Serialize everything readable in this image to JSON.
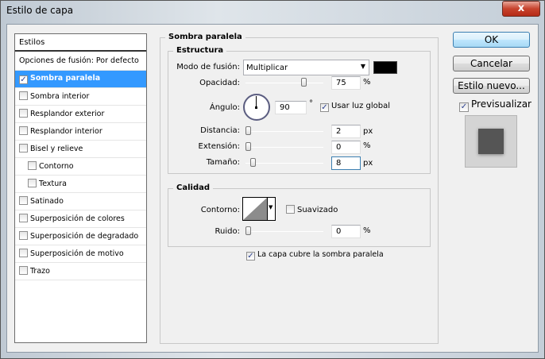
{
  "window": {
    "title": "Estilo de capa",
    "close": "x"
  },
  "sidebar": {
    "header": "Estilos",
    "items": [
      {
        "label": "Opciones de fusión: Por defecto",
        "checkbox": false
      },
      {
        "label": "Sombra paralela",
        "checked": true,
        "selected": true
      },
      {
        "label": "Sombra interior",
        "checked": false
      },
      {
        "label": "Resplandor exterior",
        "checked": false
      },
      {
        "label": "Resplandor interior",
        "checked": false
      },
      {
        "label": "Bisel y relieve",
        "checked": false
      },
      {
        "label": "Contorno",
        "checked": false,
        "indent": true
      },
      {
        "label": "Textura",
        "checked": false,
        "indent": true
      },
      {
        "label": "Satinado",
        "checked": false
      },
      {
        "label": "Superposición de colores",
        "checked": false
      },
      {
        "label": "Superposición de degradado",
        "checked": false
      },
      {
        "label": "Superposición de motivo",
        "checked": false
      },
      {
        "label": "Trazo",
        "checked": false
      }
    ]
  },
  "panel": {
    "title": "Sombra paralela",
    "structure": {
      "title": "Estructura",
      "blend_label": "Modo de fusión:",
      "blend_value": "Multiplicar",
      "color": "#000000",
      "opacity_label": "Opacidad:",
      "opacity": "75",
      "opacity_unit": "%",
      "angle_label": "Ángulo:",
      "angle": "90",
      "angle_unit": "°",
      "global_light": "Usar luz global",
      "global_light_checked": true,
      "distance_label": "Distancia:",
      "distance": "2",
      "distance_unit": "px",
      "spread_label": "Extensión:",
      "spread": "0",
      "spread_unit": "%",
      "size_label": "Tamaño:",
      "size": "8",
      "size_unit": "px"
    },
    "quality": {
      "title": "Calidad",
      "contour_label": "Contorno:",
      "antialias": "Suavizado",
      "antialias_checked": false,
      "noise_label": "Ruido:",
      "noise": "0",
      "noise_unit": "%"
    },
    "knockout": "La capa cubre la sombra paralela",
    "knockout_checked": true
  },
  "buttons": {
    "ok": "OK",
    "cancel": "Cancelar",
    "new_style": "Estilo nuevo...",
    "preview": "Previsualizar",
    "preview_checked": true
  }
}
